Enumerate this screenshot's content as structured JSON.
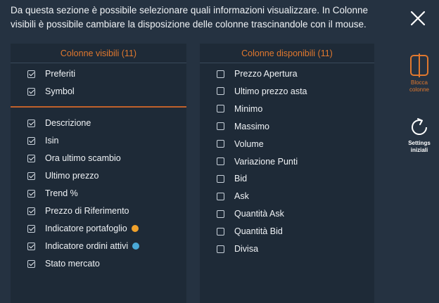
{
  "intro_text": "Da questa sezione è possibile selezionare quali informazioni visualizzare. In Colonne visibili è possibile cambiare la disposizione delle colonne trascinandole con il mouse.",
  "visible_panel": {
    "title": "Colonne visibili",
    "count": "(11)",
    "pinned": [
      {
        "label": "Preferiti",
        "checked": true
      },
      {
        "label": "Symbol",
        "checked": true
      }
    ],
    "items": [
      {
        "label": "Descrizione",
        "checked": true
      },
      {
        "label": "Isin",
        "checked": true
      },
      {
        "label": "Ora ultimo scambio",
        "checked": true
      },
      {
        "label": "Ultimo prezzo",
        "checked": true
      },
      {
        "label": "Trend %",
        "checked": true
      },
      {
        "label": "Prezzo di Riferimento",
        "checked": true
      },
      {
        "label": "Indicatore portafoglio",
        "checked": true,
        "dot_color": "#f0a12b"
      },
      {
        "label": "Indicatore ordini attivi",
        "checked": true,
        "dot_color": "#4aa9d8"
      },
      {
        "label": "Stato mercato",
        "checked": true
      }
    ]
  },
  "available_panel": {
    "title": "Colonne disponibili",
    "count": "(11)",
    "items": [
      {
        "label": "Prezzo Apertura",
        "checked": false
      },
      {
        "label": "Ultimo prezzo asta",
        "checked": false
      },
      {
        "label": "Minimo",
        "checked": false
      },
      {
        "label": "Massimo",
        "checked": false
      },
      {
        "label": "Volume",
        "checked": false
      },
      {
        "label": "Variazione Punti",
        "checked": false
      },
      {
        "label": "Bid",
        "checked": false
      },
      {
        "label": "Ask",
        "checked": false
      },
      {
        "label": "Quantità Ask",
        "checked": false
      },
      {
        "label": "Quantità Bid",
        "checked": false
      },
      {
        "label": "Divisa",
        "checked": false
      }
    ]
  },
  "side_buttons": {
    "lock": {
      "line1": "Blocca",
      "line2": "colonne",
      "icon": "lock-columns-icon",
      "color": "#e0782e"
    },
    "reset": {
      "line1": "Settings",
      "line2": "iniziali",
      "icon": "reset-icon"
    }
  }
}
